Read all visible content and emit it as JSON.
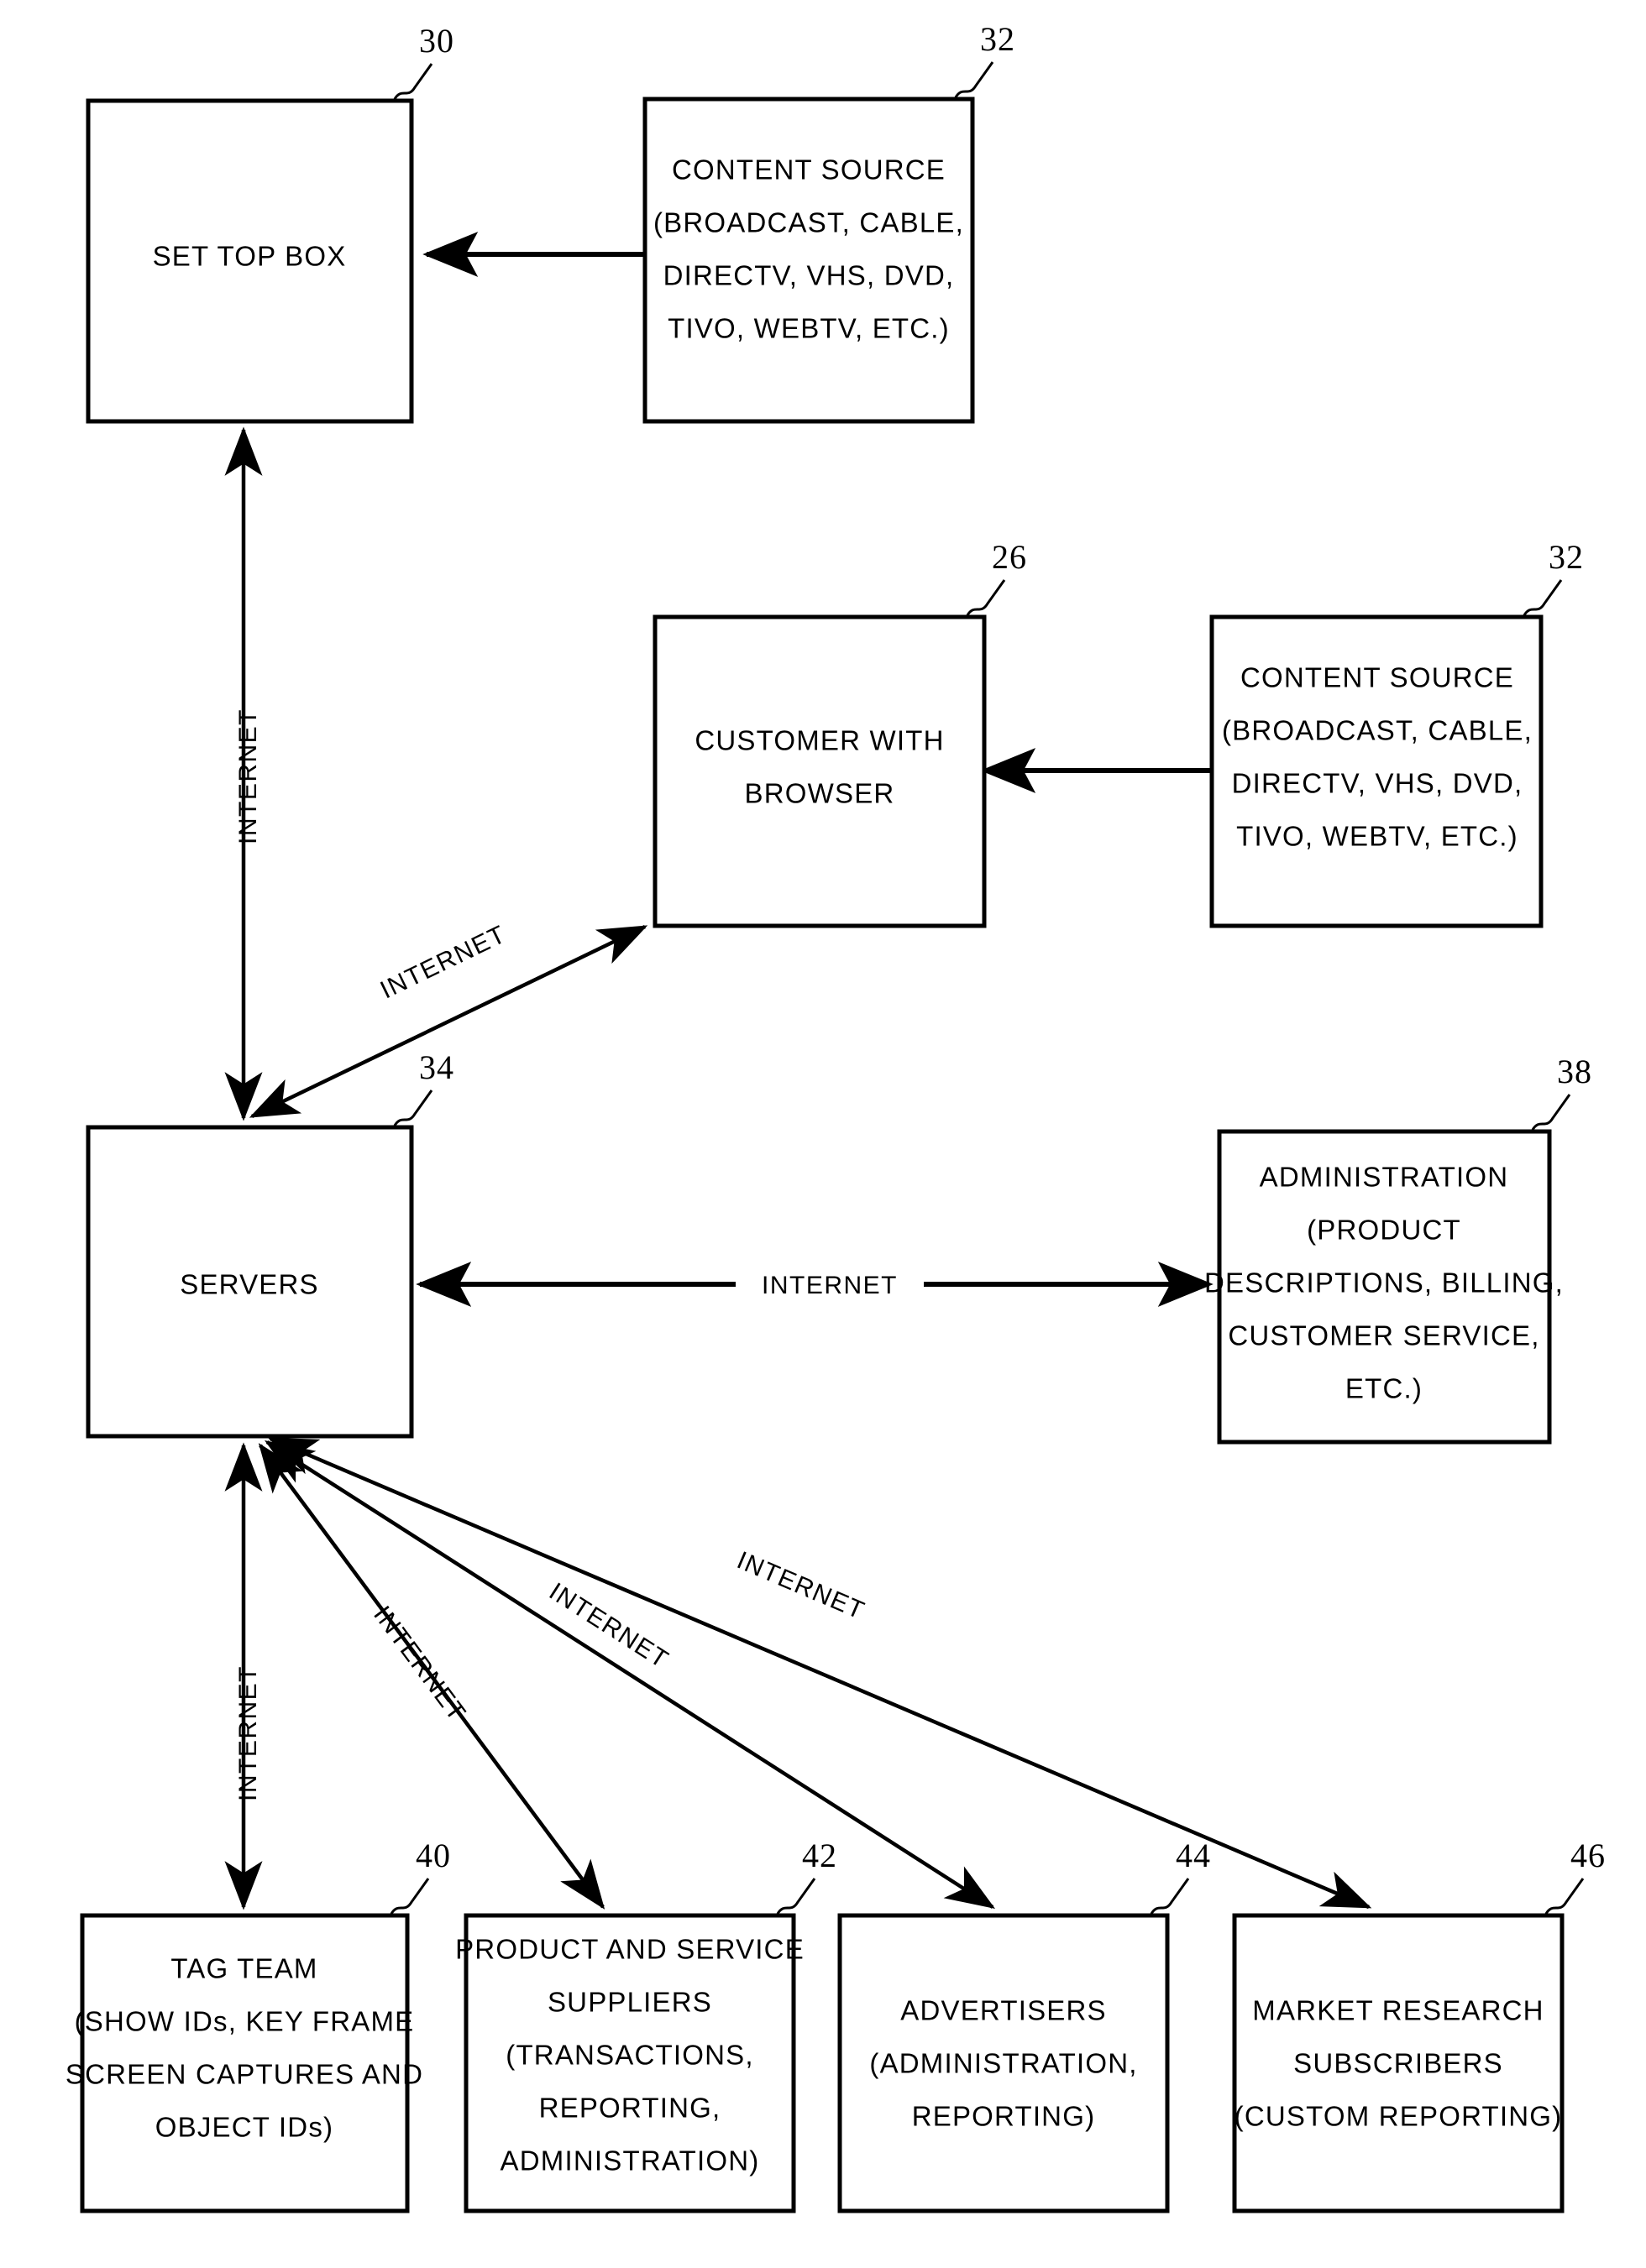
{
  "figure": {
    "type": "patent-block-diagram",
    "background_color": "#ffffff",
    "line_color": "#000000"
  },
  "nodes": [
    {
      "id": "set-top-box",
      "ref": "30",
      "lines": [
        "SET TOP BOX"
      ]
    },
    {
      "id": "content-source-top",
      "ref": "32",
      "lines": [
        "CONTENT SOURCE",
        "(BROADCAST, CABLE,",
        "DIRECTV, VHS, DVD,",
        "TIVO, WEBTV, ETC.)"
      ]
    },
    {
      "id": "customer-with-browser",
      "ref": "26",
      "lines": [
        "CUSTOMER WITH",
        "BROWSER"
      ]
    },
    {
      "id": "content-source-middle",
      "ref": "32",
      "lines": [
        "CONTENT SOURCE",
        "(BROADCAST, CABLE,",
        "DIRECTV, VHS, DVD,",
        "TIVO, WEBTV, ETC.)"
      ]
    },
    {
      "id": "servers",
      "ref": "34",
      "lines": [
        "SERVERS"
      ]
    },
    {
      "id": "administration",
      "ref": "38",
      "lines": [
        "ADMINISTRATION",
        "(PRODUCT",
        "DESCRIPTIONS, BILLING,",
        "CUSTOMER SERVICE,",
        "ETC.)"
      ]
    },
    {
      "id": "tag-team",
      "ref": "40",
      "lines": [
        "TAG TEAM",
        "(SHOW IDs, KEY FRAME",
        "SCREEN CAPTURES AND",
        "OBJECT IDs)"
      ]
    },
    {
      "id": "product-and-service-suppliers",
      "ref": "42",
      "lines": [
        "PRODUCT AND SERVICE",
        "SUPPLIERS",
        "(TRANSACTIONS,",
        "REPORTING,",
        "ADMINISTRATION)"
      ]
    },
    {
      "id": "advertisers",
      "ref": "44",
      "lines": [
        "ADVERTISERS",
        "(ADMINISTRATION,",
        "REPORTING)"
      ]
    },
    {
      "id": "market-research-subscribers",
      "ref": "46",
      "lines": [
        "MARKET RESEARCH",
        "SUBSCRIBERS",
        "(CUSTOM REPORTING)"
      ]
    }
  ],
  "edges": [
    {
      "id": "content-source-top-to-set-top-box",
      "label": "",
      "from": "content-source-top",
      "to": "set-top-box",
      "arrows": "single"
    },
    {
      "id": "content-source-middle-to-customer",
      "label": "",
      "from": "content-source-middle",
      "to": "customer-with-browser",
      "arrows": "single"
    },
    {
      "id": "set-top-box-to-servers",
      "label": "INTERNET",
      "from": "set-top-box",
      "to": "servers",
      "arrows": "double"
    },
    {
      "id": "customer-to-servers",
      "label": "INTERNET",
      "from": "customer-with-browser",
      "to": "servers",
      "arrows": "double"
    },
    {
      "id": "servers-to-administration",
      "label": "INTERNET",
      "from": "servers",
      "to": "administration",
      "arrows": "double"
    },
    {
      "id": "servers-to-tag-team",
      "label": "INTERNET",
      "from": "servers",
      "to": "tag-team",
      "arrows": "double"
    },
    {
      "id": "servers-to-product-and-service-suppliers",
      "label": "INTERNET",
      "from": "servers",
      "to": "product-and-service-suppliers",
      "arrows": "double"
    },
    {
      "id": "servers-to-advertisers",
      "label": "INTERNET",
      "from": "servers",
      "to": "advertisers",
      "arrows": "double"
    },
    {
      "id": "servers-to-market-research-subscribers",
      "label": "INTERNET",
      "from": "servers",
      "to": "market-research-subscribers",
      "arrows": "double"
    }
  ]
}
